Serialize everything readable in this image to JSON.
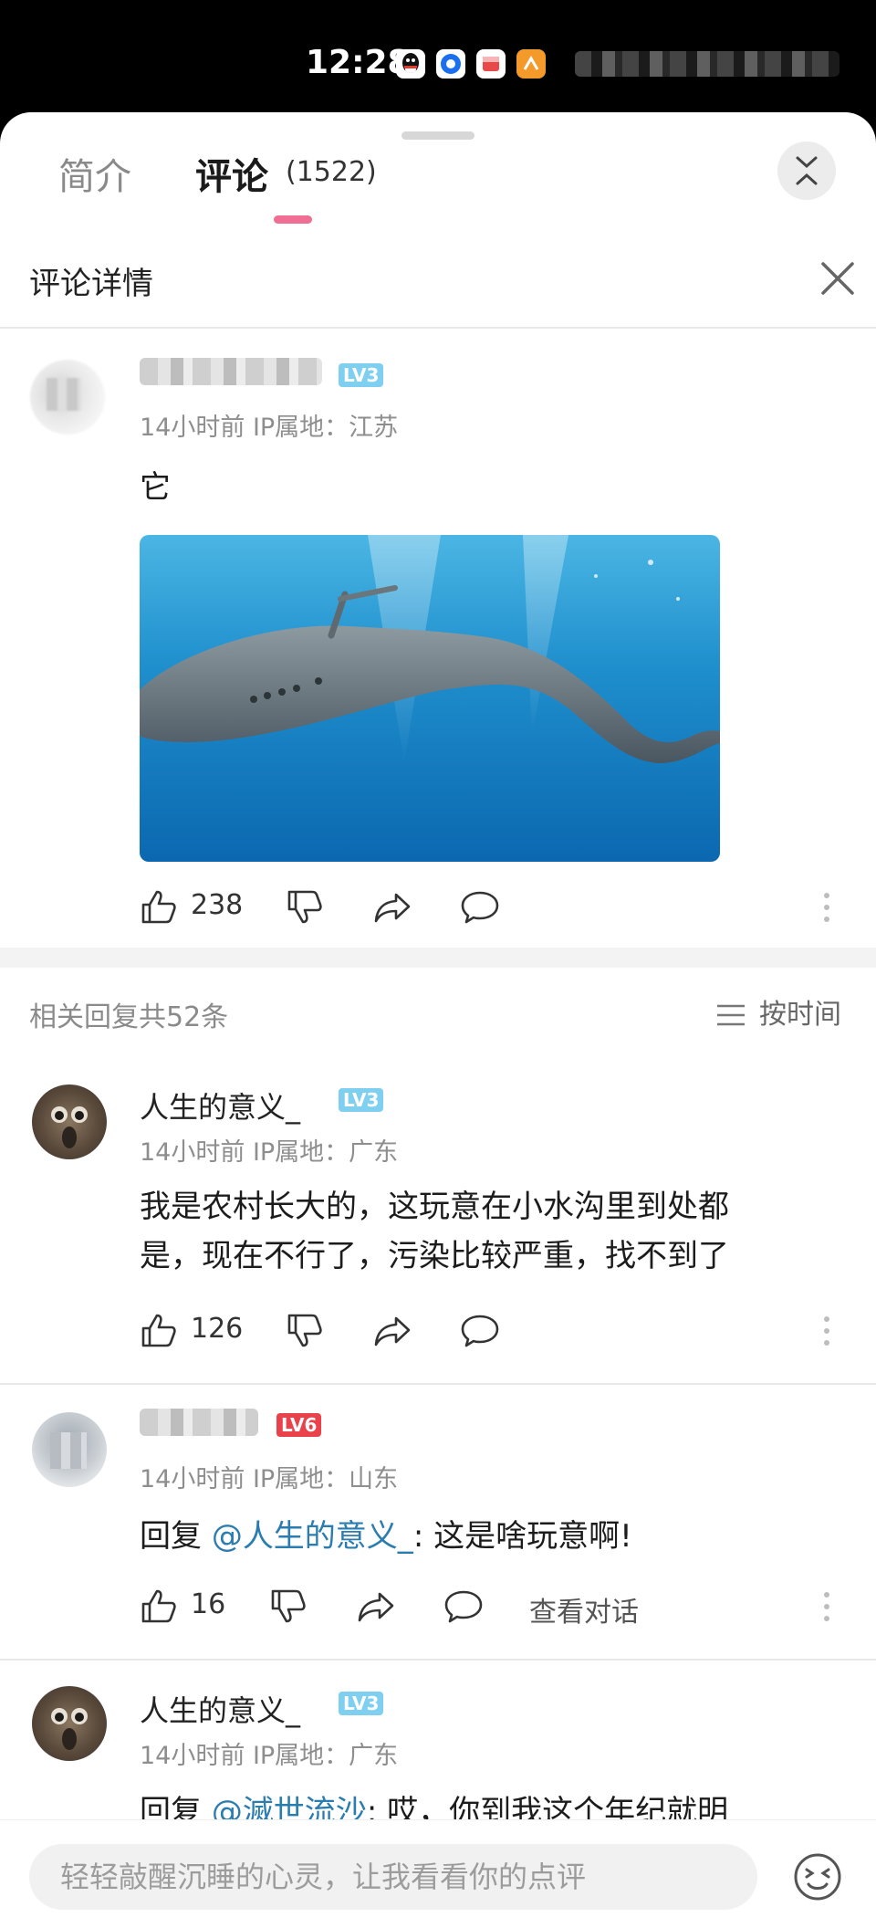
{
  "status_bar": {
    "time": "12:28"
  },
  "tabs": {
    "intro": "简介",
    "comments": "评论",
    "comments_count": "(1522)"
  },
  "detail": {
    "title": "评论详情"
  },
  "main_comment": {
    "level": "LV3",
    "meta": "14小时前 IP属地：江苏",
    "text": "它",
    "likes": "238"
  },
  "replies_header": {
    "count_text": "相关回复共52条",
    "sort_label": "按时间"
  },
  "replies": [
    {
      "username": "人生的意义_",
      "level": "LV3",
      "meta": "14小时前 IP属地：广东",
      "text_line1": "我是农村长大的，这玩意在小水沟里到处都",
      "text_line2": "是，现在不行了，污染比较严重，找不到了",
      "likes": "126"
    },
    {
      "level": "LV6",
      "meta": "14小时前 IP属地：山东",
      "reply_prefix": "回复 ",
      "mention": "@人生的意义_",
      "text": ": 这是啥玩意啊!",
      "likes": "16",
      "view_dialog": "查看对话"
    },
    {
      "username": "人生的意义_",
      "level": "LV3",
      "meta": "14小时前 IP属地：广东",
      "reply_prefix": "回复 ",
      "mention": "@滅世流沙",
      "text": ": 哎，你到我这个年纪就明"
    }
  ],
  "input_bar": {
    "placeholder": "轻轻敲醒沉睡的心灵，让我看看你的点评"
  },
  "colors": {
    "accent_pink": "#f06d93",
    "mention_blue": "#2b7db0",
    "lv3": "#7fd0f0",
    "lv6": "#e9424a"
  }
}
